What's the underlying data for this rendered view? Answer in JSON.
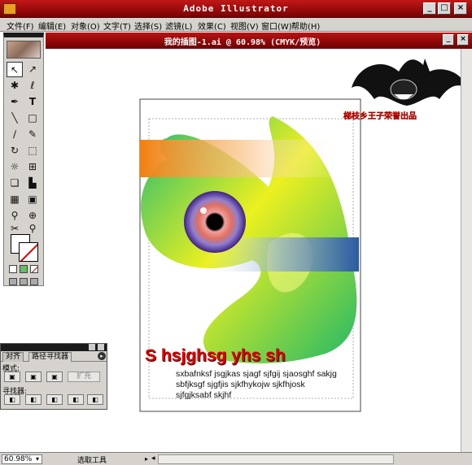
{
  "window": {
    "title": "Adobe Illustrator"
  },
  "menu": [
    "文件(F)",
    "编辑(E)",
    "对象(O)",
    "文字(T)",
    "选择(S)",
    "滤镜(L)",
    "效果(C)",
    "视图(V)",
    "窗口(W)",
    "帮助(H)"
  ],
  "document": {
    "title": "我的插图-1.ai @ 60.98% (CMYK/预览)"
  },
  "artwork": {
    "heading": "S hsjghsg yhs sh",
    "body_lines": [
      "sxbafnksf jsgjkas sjagf sjfgij sjaosghf sakjg",
      "sbfjksgf sjgfjis sjkfhykojw sjkfhjosk",
      "sjfgjksabf skjhf"
    ],
    "watermark": "梯枝乡王子荣誉出品"
  },
  "panel": {
    "tabs": [
      "对齐",
      "路径寻找器"
    ],
    "mode_label": "模式:",
    "finder_label": "寻找器:",
    "expand_label": "扩充"
  },
  "status": {
    "zoom": "60.98%",
    "tool": "选取工具"
  },
  "colors": {
    "titlebar": "#a01010",
    "chrome": "#d6d3ce",
    "heading_red": "#e00000"
  }
}
